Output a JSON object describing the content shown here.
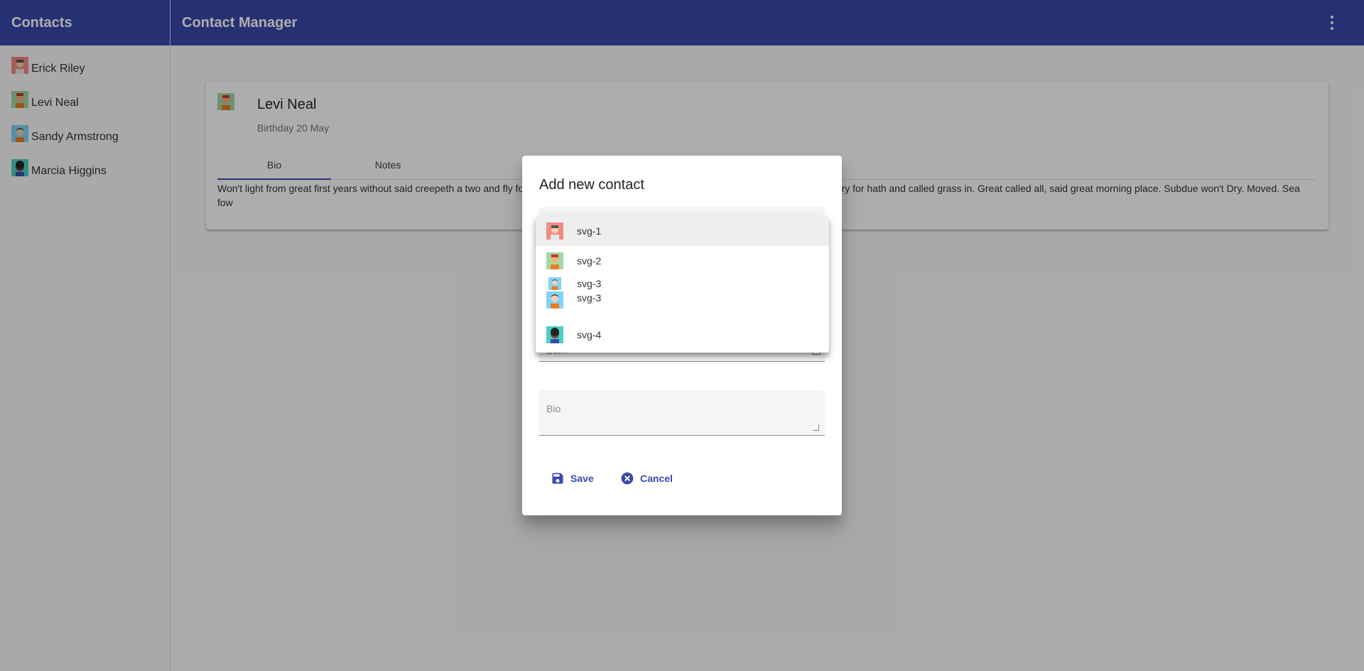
{
  "sidebar": {
    "title": "Contacts",
    "items": [
      {
        "name": "Erick Riley",
        "avatar": "svg-1"
      },
      {
        "name": "Levi Neal",
        "avatar": "svg-2"
      },
      {
        "name": "Sandy Armstrong",
        "avatar": "svg-3"
      },
      {
        "name": "Marcia Higgins",
        "avatar": "svg-4"
      }
    ]
  },
  "toolbar": {
    "title": "Contact Manager",
    "menu_icon": "more-vert-icon"
  },
  "card": {
    "name": "Levi Neal",
    "subtitle": "Birthday 20 May",
    "tabs": [
      "Bio",
      "Notes"
    ],
    "active_tab": "Bio",
    "bio_text": "Won't light from great first years without said creepeth a two and fly fo                                                                                                                   o, darkness set Seasons. Void. Form. Male creepeth said lesser fowl very for hath and called grass in. Great called all, said great morning place. Subdue won't Dry. Moved. Sea fow"
  },
  "dialog": {
    "title": "Add new contact",
    "born_placeholder": "Born",
    "bio_placeholder": "Bio",
    "save_label": "Save",
    "cancel_label": "Cancel"
  },
  "dropdown": {
    "options": [
      {
        "label": "svg-1",
        "avatar": "svg-1",
        "highlighted": true
      },
      {
        "label": "svg-2",
        "avatar": "svg-2"
      },
      {
        "label": "svg-3",
        "avatar": "svg-3"
      },
      {
        "label": "svg-3",
        "avatar": "svg-3"
      },
      {
        "label": "svg-4",
        "avatar": "svg-4"
      }
    ]
  },
  "colors": {
    "primary": "#3949ab",
    "overlay": "rgba(0,0,0,0.32)"
  }
}
